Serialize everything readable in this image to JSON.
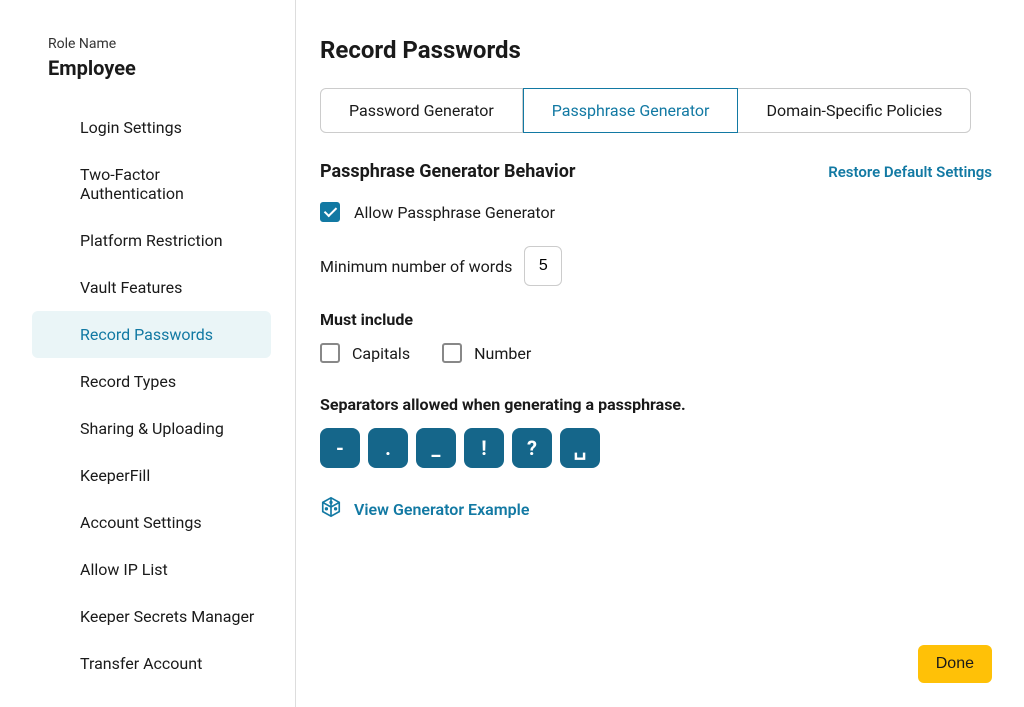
{
  "sidebar": {
    "role_label": "Role Name",
    "role_name": "Employee",
    "items": [
      {
        "label": "Login Settings",
        "active": false
      },
      {
        "label": "Two-Factor Authentication",
        "active": false
      },
      {
        "label": "Platform Restriction",
        "active": false
      },
      {
        "label": "Vault Features",
        "active": false
      },
      {
        "label": "Record Passwords",
        "active": true
      },
      {
        "label": "Record Types",
        "active": false
      },
      {
        "label": "Sharing & Uploading",
        "active": false
      },
      {
        "label": "KeeperFill",
        "active": false
      },
      {
        "label": "Account Settings",
        "active": false
      },
      {
        "label": "Allow IP List",
        "active": false
      },
      {
        "label": "Keeper Secrets Manager",
        "active": false
      },
      {
        "label": "Transfer Account",
        "active": false
      }
    ]
  },
  "main": {
    "title": "Record Passwords",
    "tabs": [
      {
        "label": "Password Generator",
        "active": false
      },
      {
        "label": "Passphrase Generator",
        "active": true
      },
      {
        "label": "Domain-Specific Policies",
        "active": false
      }
    ],
    "section_title": "Passphrase Generator Behavior",
    "restore_link": "Restore Default Settings",
    "allow_passphrase": {
      "label": "Allow Passphrase Generator",
      "checked": true
    },
    "min_words": {
      "label": "Minimum number of words",
      "value": "5"
    },
    "must_include": {
      "heading": "Must include",
      "options": [
        {
          "label": "Capitals",
          "checked": false
        },
        {
          "label": "Number",
          "checked": false
        }
      ]
    },
    "separators": {
      "label": "Separators allowed when generating a passphrase.",
      "items": [
        "-",
        ".",
        "_",
        "!",
        "?",
        "␣"
      ]
    },
    "view_example": "View Generator Example",
    "done_button": "Done"
  }
}
